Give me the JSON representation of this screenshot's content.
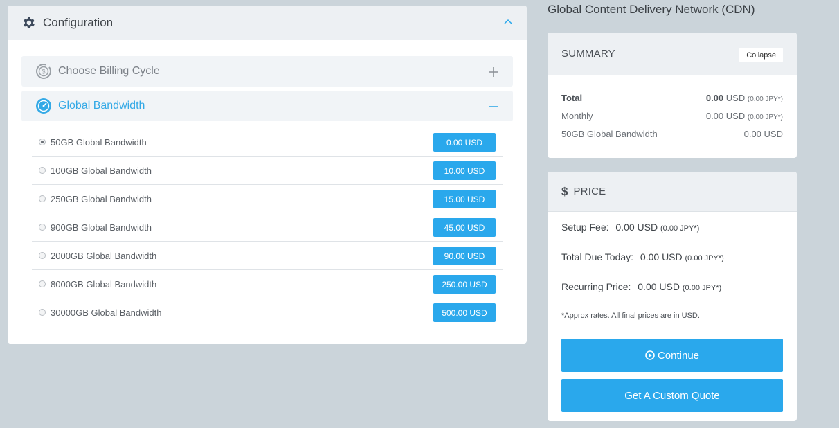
{
  "config": {
    "title": "Configuration",
    "sections": [
      {
        "label": "Choose Billing Cycle",
        "icon": "billing-cycle-icon",
        "state": "collapsed"
      },
      {
        "label": "Global Bandwidth",
        "icon": "speedometer-icon",
        "state": "expanded"
      }
    ],
    "options": [
      {
        "label": "50GB Global Bandwidth",
        "price": "0.00 USD",
        "selected": true
      },
      {
        "label": "100GB Global Bandwidth",
        "price": "10.00 USD",
        "selected": false
      },
      {
        "label": "250GB Global Bandwidth",
        "price": "15.00 USD",
        "selected": false
      },
      {
        "label": "900GB Global Bandwidth",
        "price": "45.00 USD",
        "selected": false
      },
      {
        "label": "2000GB Global Bandwidth",
        "price": "90.00 USD",
        "selected": false
      },
      {
        "label": "8000GB Global Bandwidth",
        "price": "250.00 USD",
        "selected": false
      },
      {
        "label": "30000GB Global Bandwidth",
        "price": "500.00 USD",
        "selected": false
      }
    ]
  },
  "product_title": "Global Content Delivery Network (CDN)",
  "summary": {
    "title": "SUMMARY",
    "collapse_label": "Collapse",
    "rows": [
      {
        "label": "Total",
        "amount": "0.00",
        "currency": "USD",
        "jpy": "(0.00 JPY*)"
      },
      {
        "label": "Monthly",
        "amount": "0.00",
        "currency": "USD",
        "jpy": "(0.00 JPY*)"
      },
      {
        "label": "50GB Global Bandwidth",
        "amount": "0.00",
        "currency": "USD"
      }
    ]
  },
  "price": {
    "title": "PRICE",
    "setup_fee": {
      "label": "Setup Fee:",
      "amount": "0.00",
      "currency": "USD",
      "jpy": "(0.00 JPY*)"
    },
    "total_due": {
      "label": "Total Due Today:",
      "amount": "0.00",
      "currency": "USD",
      "jpy": "(0.00 JPY*)"
    },
    "recurring": {
      "label": "Recurring Price:",
      "amount": "0.00",
      "currency": "USD",
      "jpy": "(0.00 JPY*)"
    },
    "note": "*Approx rates. All final prices are in USD.",
    "continue_label": "Continue",
    "quote_label": "Get A Custom Quote"
  },
  "colors": {
    "accent": "#2aa8ec",
    "background": "#cbd4da",
    "panel_header": "#edf0f3"
  }
}
